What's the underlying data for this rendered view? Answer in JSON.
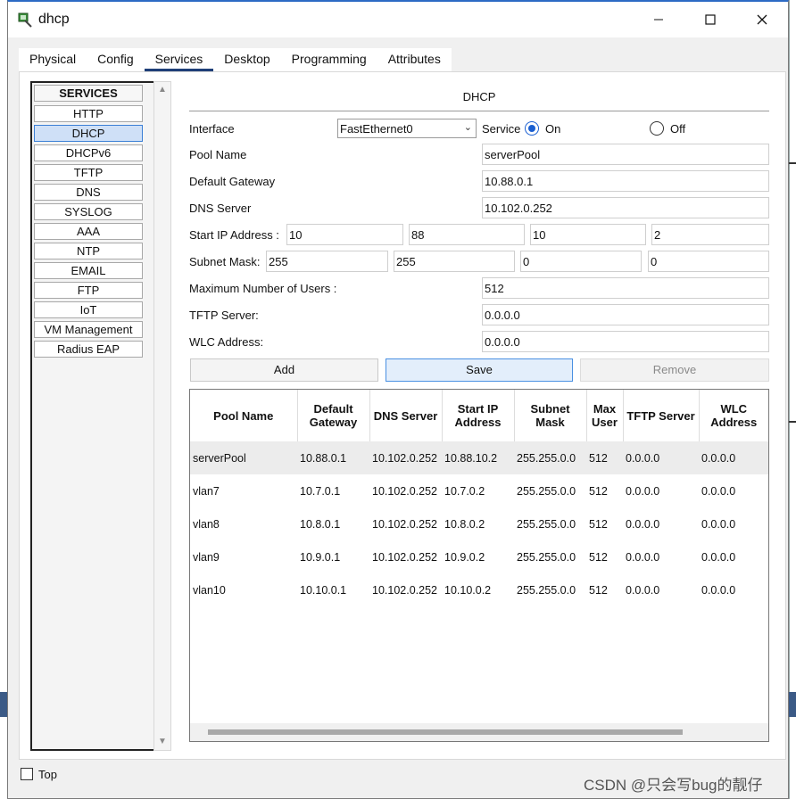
{
  "window": {
    "title": "dhcp"
  },
  "tabs": [
    {
      "label": "Physical"
    },
    {
      "label": "Config"
    },
    {
      "label": "Services"
    },
    {
      "label": "Desktop"
    },
    {
      "label": "Programming"
    },
    {
      "label": "Attributes"
    }
  ],
  "sidebar": {
    "items": [
      {
        "label": "SERVICES"
      },
      {
        "label": "HTTP"
      },
      {
        "label": "DHCP"
      },
      {
        "label": "DHCPv6"
      },
      {
        "label": "TFTP"
      },
      {
        "label": "DNS"
      },
      {
        "label": "SYSLOG"
      },
      {
        "label": "AAA"
      },
      {
        "label": "NTP"
      },
      {
        "label": "EMAIL"
      },
      {
        "label": "FTP"
      },
      {
        "label": "IoT"
      },
      {
        "label": "VM Management"
      },
      {
        "label": "Radius EAP"
      }
    ],
    "selected": "DHCP"
  },
  "dhcp": {
    "title": "DHCP",
    "interface_label": "Interface",
    "interface_value": "FastEthernet0",
    "service_label": "Service",
    "on_label": "On",
    "off_label": "Off",
    "service_state": "On",
    "pool_name_label": "Pool Name",
    "pool_name": "serverPool",
    "gateway_label": "Default Gateway",
    "gateway": "10.88.0.1",
    "dns_label": "DNS Server",
    "dns": "10.102.0.252",
    "start_ip_label": "Start IP Address :",
    "start_ip": [
      "10",
      "88",
      "10",
      "2"
    ],
    "subnet_label": "Subnet Mask:",
    "subnet": [
      "255",
      "255",
      "0",
      "0"
    ],
    "max_users_label": "Maximum Number of Users :",
    "max_users": "512",
    "tftp_label": "TFTP Server:",
    "tftp": "0.0.0.0",
    "wlc_label": "WLC Address:",
    "wlc": "0.0.0.0",
    "add_label": "Add",
    "save_label": "Save",
    "remove_label": "Remove"
  },
  "table": {
    "columns": [
      "Pool Name",
      "Default Gateway",
      "DNS Server",
      "Start IP Address",
      "Subnet Mask",
      "Max User",
      "TFTP Server",
      "WLC Address"
    ],
    "rows": [
      [
        "serverPool",
        "10.88.0.1",
        "10.102.0.252",
        "10.88.10.2",
        "255.255.0.0",
        "512",
        "0.0.0.0",
        "0.0.0.0"
      ],
      [
        "vlan7",
        "10.7.0.1",
        "10.102.0.252",
        "10.7.0.2",
        "255.255.0.0",
        "512",
        "0.0.0.0",
        "0.0.0.0"
      ],
      [
        "vlan8",
        "10.8.0.1",
        "10.102.0.252",
        "10.8.0.2",
        "255.255.0.0",
        "512",
        "0.0.0.0",
        "0.0.0.0"
      ],
      [
        "vlan9",
        "10.9.0.1",
        "10.102.0.252",
        "10.9.0.2",
        "255.255.0.0",
        "512",
        "0.0.0.0",
        "0.0.0.0"
      ],
      [
        "vlan10",
        "10.10.0.1",
        "10.102.0.252",
        "10.10.0.2",
        "255.255.0.0",
        "512",
        "0.0.0.0",
        "0.0.0.0"
      ]
    ],
    "selected_row": 0
  },
  "footer": {
    "top_label": "Top",
    "top_checked": false
  },
  "watermark": "CSDN @只会写bug的靓仔",
  "colors": {
    "accent": "#1a5fd1",
    "tab_underline": "#1f3f78",
    "selected_item": "#cfe0f7"
  }
}
